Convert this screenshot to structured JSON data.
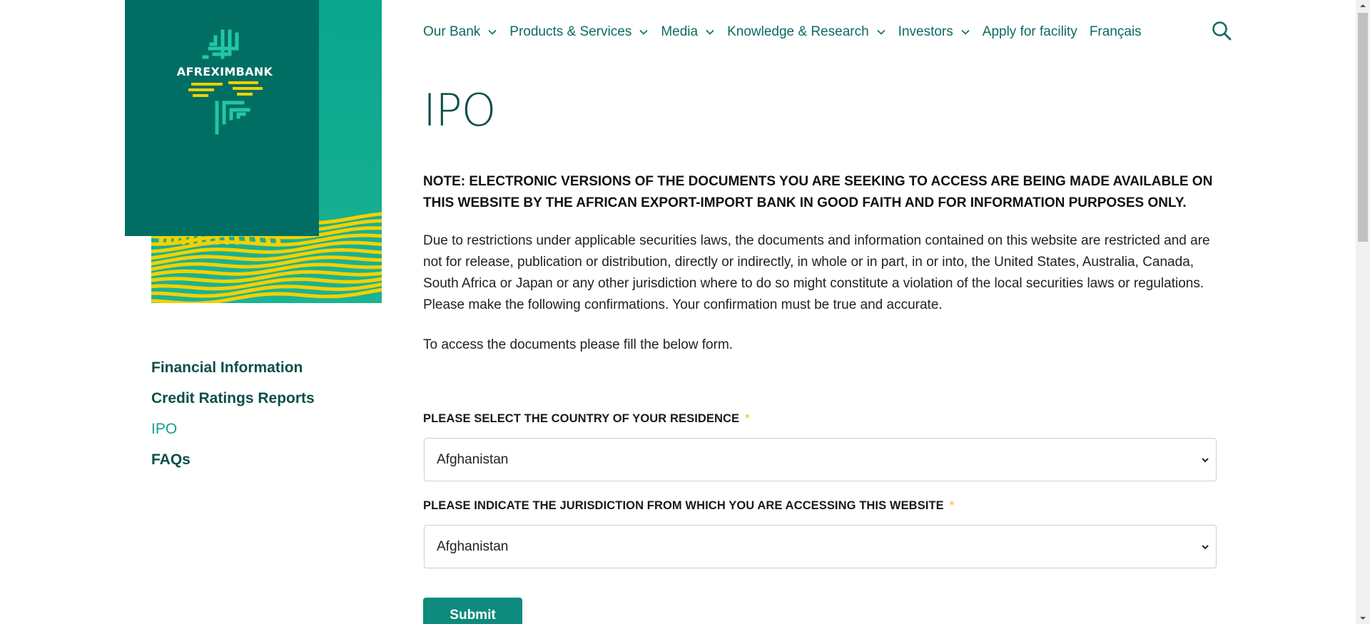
{
  "brand": {
    "logo_text": "AFREXIMBANK",
    "colors": {
      "teal": "#006e63",
      "yellow": "#f5d000",
      "green": "#1ab394"
    }
  },
  "nav": {
    "items": [
      {
        "label": "Our Bank",
        "dropdown": true
      },
      {
        "label": "Products & Services",
        "dropdown": true
      },
      {
        "label": "Media",
        "dropdown": true
      },
      {
        "label": "Knowledge & Research",
        "dropdown": true
      },
      {
        "label": "Investors",
        "dropdown": true
      },
      {
        "label": "Apply for facility",
        "dropdown": false
      },
      {
        "label": "Français",
        "dropdown": false
      }
    ],
    "search_icon": "search-icon"
  },
  "sidebar": {
    "items": [
      {
        "label": "Financial Information",
        "active": false
      },
      {
        "label": "Credit Ratings Reports",
        "active": false
      },
      {
        "label": "IPO",
        "active": true
      },
      {
        "label": "FAQs",
        "active": false
      }
    ]
  },
  "main": {
    "title": "IPO",
    "note": "NOTE: ELECTRONIC VERSIONS OF THE DOCUMENTS YOU ARE SEEKING TO ACCESS ARE BEING MADE AVAILABLE ON THIS WEBSITE BY THE AFRICAN EXPORT-IMPORT BANK IN GOOD FAITH AND FOR INFORMATION PURPOSES ONLY.",
    "paragraph": "Due to restrictions under applicable securities laws, the documents and information contained on this website are restricted and are not for release, publication or distribution, directly or indirectly, in whole or in part, in or into, the United States, Australia, Canada, South Africa or Japan or any other jurisdiction where to do so might constitute a violation of the local securities laws or regulations. Please make the following confirmations. Your confirmation must be true and accurate.",
    "instruction": "To access the documents please fill the below form."
  },
  "form": {
    "country_label": "PLEASE SELECT THE COUNTRY OF YOUR RESIDENCE",
    "country_value": "Afghanistan",
    "jurisdiction_label": "PLEASE INDICATE THE JURISDICTION FROM WHICH YOU ARE ACCESSING THIS WEBSITE",
    "jurisdiction_value": "Afghanistan",
    "required_mark": "*",
    "submit_label": "Submit"
  }
}
